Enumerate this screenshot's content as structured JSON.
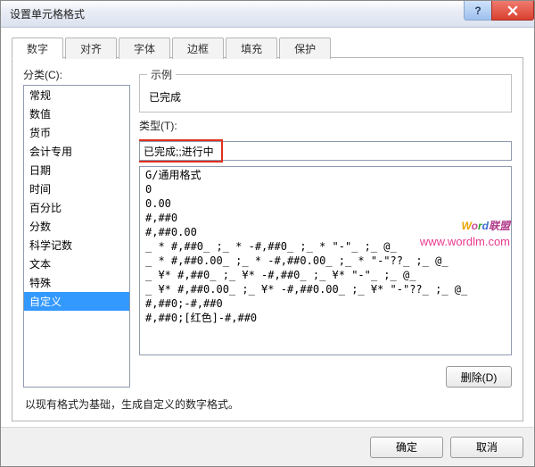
{
  "window": {
    "title": "设置单元格格式"
  },
  "tabs": [
    {
      "label": "数字",
      "active": true
    },
    {
      "label": "对齐",
      "active": false
    },
    {
      "label": "字体",
      "active": false
    },
    {
      "label": "边框",
      "active": false
    },
    {
      "label": "填充",
      "active": false
    },
    {
      "label": "保护",
      "active": false
    }
  ],
  "category": {
    "label": "分类(C):",
    "items": [
      {
        "label": "常规",
        "selected": false
      },
      {
        "label": "数值",
        "selected": false
      },
      {
        "label": "货币",
        "selected": false
      },
      {
        "label": "会计专用",
        "selected": false
      },
      {
        "label": "日期",
        "selected": false
      },
      {
        "label": "时间",
        "selected": false
      },
      {
        "label": "百分比",
        "selected": false
      },
      {
        "label": "分数",
        "selected": false
      },
      {
        "label": "科学记数",
        "selected": false
      },
      {
        "label": "文本",
        "selected": false
      },
      {
        "label": "特殊",
        "selected": false
      },
      {
        "label": "自定义",
        "selected": true
      }
    ]
  },
  "sample": {
    "legend": "示例",
    "value": "已完成"
  },
  "type": {
    "label": "类型(T):",
    "value": "已完成;;进行中"
  },
  "formats": [
    "G/通用格式",
    "0",
    "0.00",
    "#,##0",
    "#,##0.00",
    "_ * #,##0_ ;_ * -#,##0_ ;_ * \"-\"_ ;_ @_ ",
    "_ * #,##0.00_ ;_ * -#,##0.00_ ;_ * \"-\"??_ ;_ @_ ",
    "_ ¥* #,##0_ ;_ ¥* -#,##0_ ;_ ¥* \"-\"_ ;_ @_ ",
    "_ ¥* #,##0.00_ ;_ ¥* -#,##0.00_ ;_ ¥* \"-\"??_ ;_ @_ ",
    "#,##0;-#,##0",
    "#,##0;[红色]-#,##0"
  ],
  "buttons": {
    "delete": "删除(D)",
    "ok": "确定",
    "cancel": "取消"
  },
  "hint": "以现有格式为基础，生成自定义的数字格式。",
  "watermark": {
    "line1": "Word联盟",
    "line2": "www.wordlm.com"
  }
}
